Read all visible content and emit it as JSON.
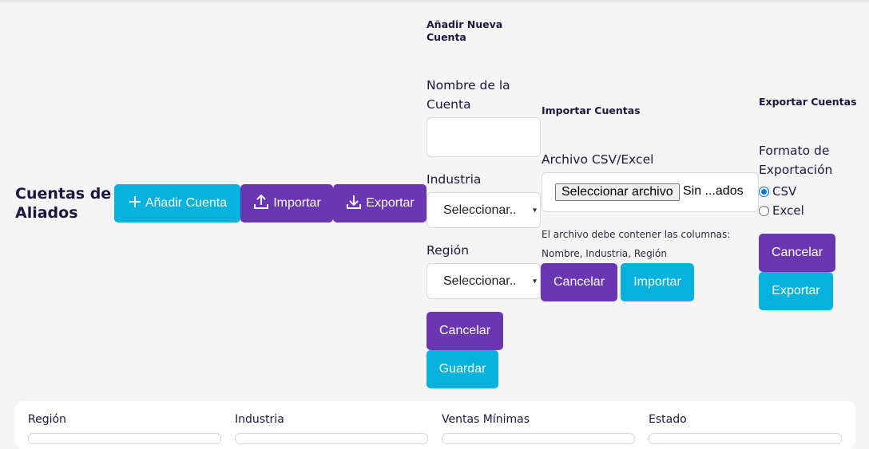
{
  "page": {
    "title": "Cuentas de Aliados"
  },
  "toolbar": {
    "add_label": "Añadir Cuenta",
    "import_label": "Importar",
    "export_label": "Exportar"
  },
  "add_form": {
    "heading": "Añadir Nueva Cuenta",
    "name_label": "Nombre de la Cuenta",
    "name_value": "",
    "industry_label": "Industria",
    "industry_value": "Seleccionar..",
    "region_label": "Región",
    "region_value": "Seleccionar..",
    "cancel_label": "Cancelar",
    "save_label": "Guardar"
  },
  "import_form": {
    "heading": "Importar Cuentas",
    "file_label": "Archivo CSV/Excel",
    "file_button": "Seleccionar archivo",
    "file_status": "Sin ...ados",
    "hint_line1": "El archivo debe contener las columnas:",
    "hint_line2": "Nombre, Industria, Región",
    "cancel_label": "Cancelar",
    "import_label": "Importar"
  },
  "export_form": {
    "heading": "Exportar Cuentas",
    "format_label": "Formato de Exportación",
    "options": [
      {
        "label": "CSV",
        "checked": true
      },
      {
        "label": "Excel",
        "checked": false
      }
    ],
    "cancel_label": "Cancelar",
    "export_label": "Exportar"
  },
  "filters": {
    "region": "Región",
    "industry": "Industria",
    "min_sales": "Ventas Mínimas",
    "status": "Estado"
  },
  "colors": {
    "primary_cyan": "#05b1dd",
    "primary_purple": "#6a36b2",
    "text_dark": "#1f1640"
  }
}
